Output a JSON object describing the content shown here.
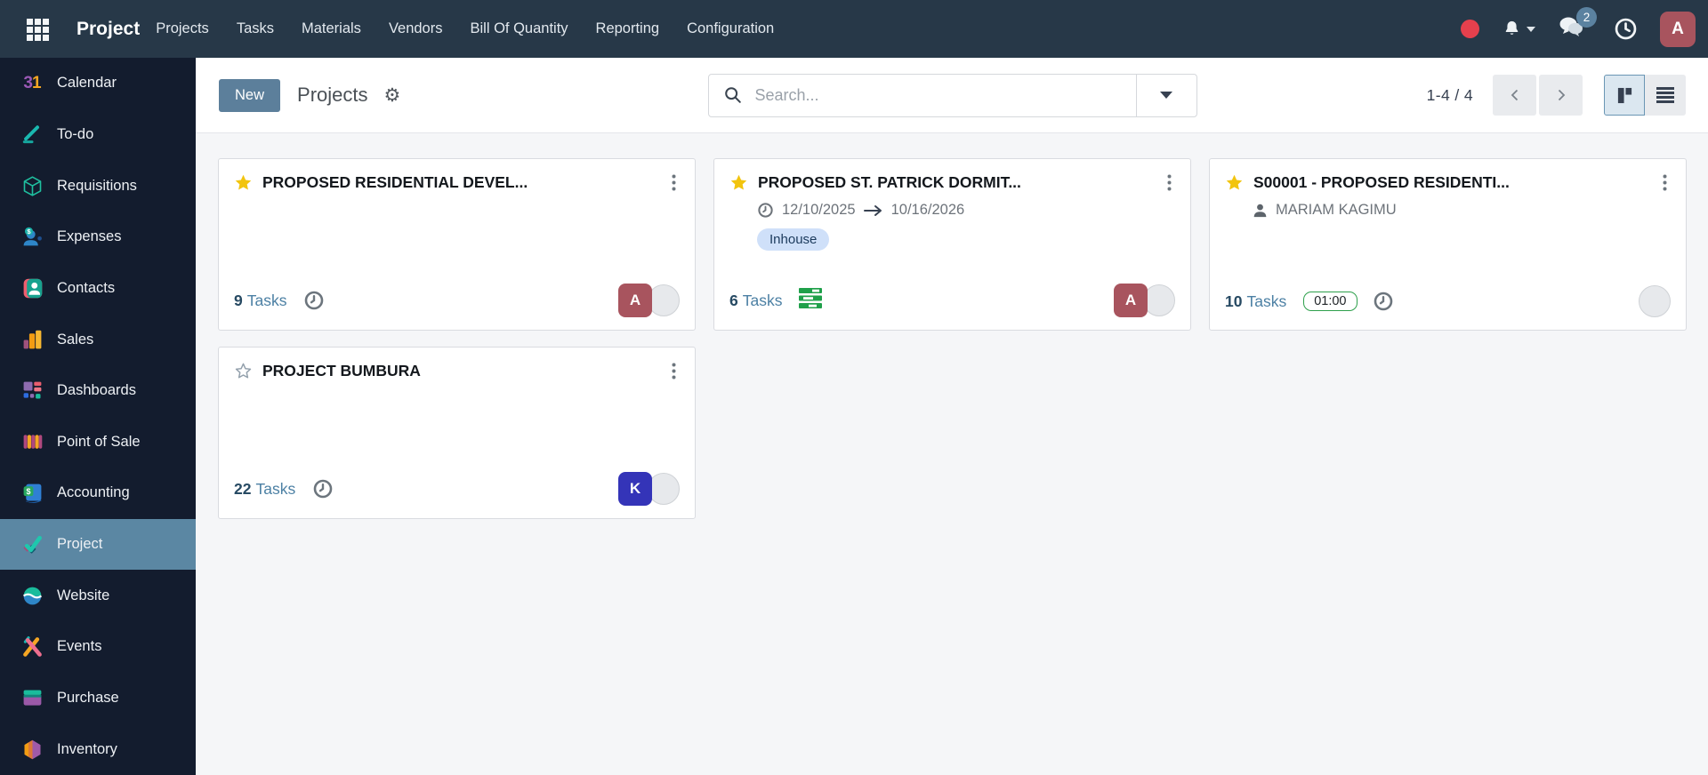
{
  "topbar": {
    "app_name": "Project",
    "menu_items": [
      "Projects",
      "Tasks",
      "Materials",
      "Vendors",
      "Bill Of Quantity",
      "Reporting",
      "Configuration"
    ],
    "messages_badge": "2",
    "user_initial": "A",
    "colors": {
      "bar_bg": "#273848",
      "status_dot": "#e5404d",
      "badge_bg": "#5b82a0",
      "user_avatar_bg": "#a8545e"
    }
  },
  "sidebar": {
    "active_item": "Project",
    "colors": {
      "bg": "#131c2e",
      "active_bg": "#5b87a3"
    },
    "items": [
      {
        "label": "Calendar"
      },
      {
        "label": "To-do"
      },
      {
        "label": "Requisitions"
      },
      {
        "label": "Expenses"
      },
      {
        "label": "Contacts"
      },
      {
        "label": "Sales"
      },
      {
        "label": "Dashboards"
      },
      {
        "label": "Point of Sale"
      },
      {
        "label": "Accounting"
      },
      {
        "label": "Project",
        "active": true
      },
      {
        "label": "Website"
      },
      {
        "label": "Events"
      },
      {
        "label": "Purchase"
      },
      {
        "label": "Inventory"
      }
    ]
  },
  "control_panel": {
    "new_label": "New",
    "breadcrumb": "Projects",
    "search_placeholder": "Search...",
    "pager_text": "1-4 / 4",
    "active_view": "kanban",
    "colors": {
      "new_button_bg": "#5c7f9b",
      "active_view_bg": "#dbe7f0",
      "active_view_border": "#6a96b4"
    }
  },
  "cards": [
    {
      "title": "PROPOSED RESIDENTIAL DEVEL...",
      "starred": true,
      "tasks_count": "9",
      "tasks_label": "Tasks",
      "avatar_initial": "A",
      "avatar_color": "#a8545e"
    },
    {
      "title": "PROPOSED ST. PATRICK DORMIT...",
      "starred": true,
      "date_start": "12/10/2025",
      "date_end": "10/16/2026",
      "tag": "Inhouse",
      "tag_colors": {
        "bg": "#cfe0f9",
        "text": "#1b3a5c"
      },
      "tasks_count": "6",
      "tasks_label": "Tasks",
      "avatar_initial": "A",
      "avatar_color": "#a8545e"
    },
    {
      "title": "S00001 - PROPOSED RESIDENTI...",
      "starred": true,
      "manager": "MARIAM KAGIMU",
      "tasks_count": "10",
      "tasks_label": "Tasks",
      "allocated_time": "01:00",
      "time_pill_border": "#2ea04c"
    },
    {
      "title": "PROJECT BUMBURA",
      "starred": false,
      "tasks_count": "22",
      "tasks_label": "Tasks",
      "avatar_initial": "K",
      "avatar_color": "#3434b8"
    }
  ],
  "icons": {
    "apps-grid-icon": "3x3 white squares",
    "bell-icon": "notification bell",
    "chat-icon": "two speech bubbles",
    "clock-icon": "clock outline with hands",
    "search-icon": "magnifier",
    "gear-icon": "⚙",
    "caret-down-icon": "▾",
    "chevron-left-icon": "‹",
    "chevron-right-icon": "›",
    "kanban-view-icon": "tall bar + square",
    "list-view-icon": "4 horizontal bars",
    "star-filled-icon": "gold star #f2c40e",
    "star-outline-icon": "gray outline star",
    "kebab-menu-icon": "3 vertical dots",
    "person-icon": "user silhouette",
    "arrow-right-icon": "→",
    "tasks-progress-icon": "3 green bars with white dashes",
    "calendar-31-icon": "31"
  }
}
